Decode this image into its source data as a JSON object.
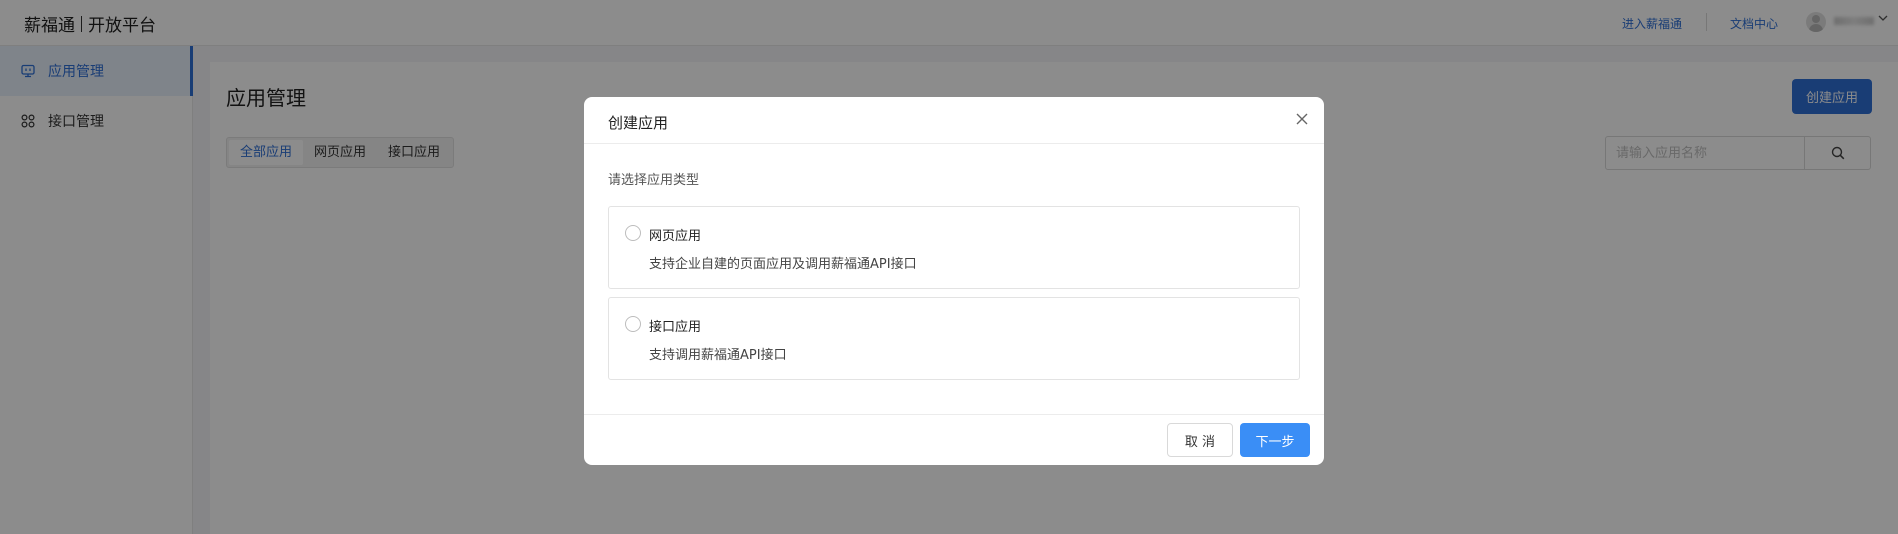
{
  "header": {
    "brand_name": "薪福通",
    "brand_sub": "开放平台",
    "link_enter": "进入薪福通",
    "link_docs": "文档中心"
  },
  "sidebar": {
    "items": [
      {
        "label": "应用管理",
        "icon": "monitor-icon",
        "active": true
      },
      {
        "label": "接口管理",
        "icon": "grid-icon",
        "active": false
      }
    ]
  },
  "main": {
    "title": "应用管理",
    "create_button": "创建应用",
    "tabs": [
      "全部应用",
      "网页应用",
      "接口应用"
    ],
    "active_tab": "全部应用",
    "search_placeholder": "请输入应用名称"
  },
  "modal": {
    "title": "创建应用",
    "prompt": "请选择应用类型",
    "options": [
      {
        "title": "网页应用",
        "description": "支持企业自建的页面应用及调用薪福通API接口"
      },
      {
        "title": "接口应用",
        "description": "支持调用薪福通API接口"
      }
    ],
    "cancel_label": "取 消",
    "next_label": "下一步"
  },
  "colors": {
    "accent": "#2f6fd6",
    "primary_button": "#3a8ef6",
    "overlay": "rgba(0,0,0,0.45)"
  }
}
